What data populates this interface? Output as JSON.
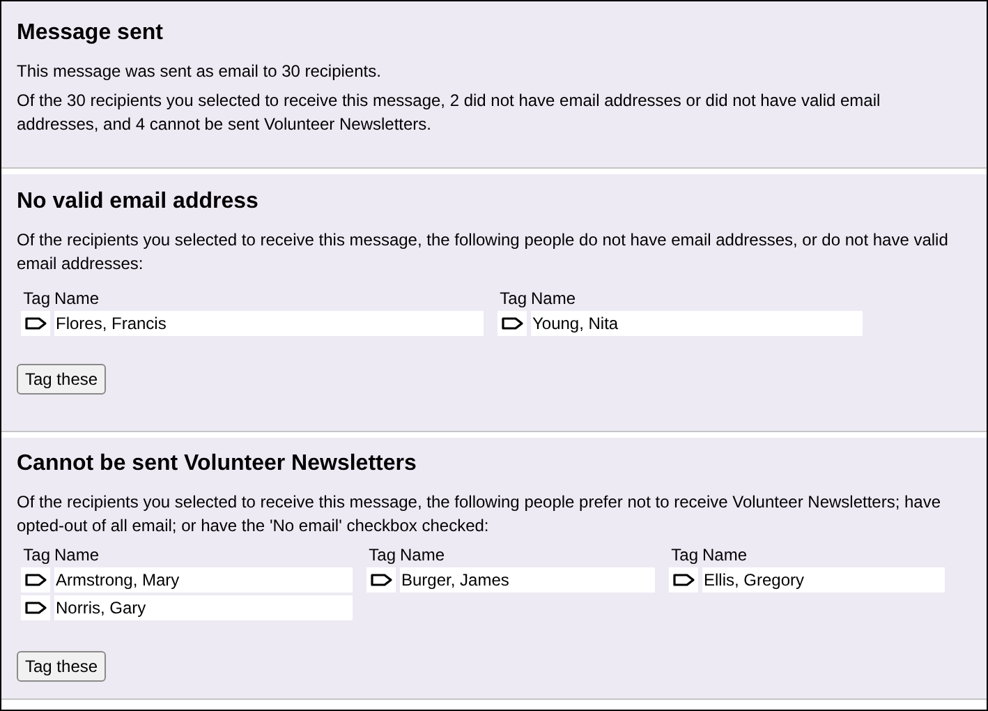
{
  "sections": [
    {
      "title": "Message sent",
      "paragraphs": [
        "This message was sent as email to 30 recipients.",
        "Of the 30 recipients you selected to receive this message, 2 did not have email addresses or did not have valid email addresses, and 4 cannot be sent Volunteer Newsletters."
      ]
    },
    {
      "title": "No valid email address",
      "paragraphs": [
        "Of the recipients you selected to receive this message, the following people do not have email addresses, or do not have valid email addresses:"
      ],
      "tables": [
        {
          "columns": [
            "Tag",
            "Name"
          ],
          "rows": [
            "Flores, Francis"
          ]
        },
        {
          "columns": [
            "Tag",
            "Name"
          ],
          "rows": [
            "Young, Nita"
          ]
        }
      ],
      "button": "Tag these"
    },
    {
      "title": "Cannot be sent Volunteer Newsletters",
      "paragraphs": [
        "Of the recipients you selected to receive this message, the following people prefer not to receive Volunteer Newsletters; have opted-out of all email; or have the 'No email' checkbox checked:"
      ],
      "tables": [
        {
          "columns": [
            "Tag",
            "Name"
          ],
          "rows": [
            "Armstrong, Mary",
            "Norris, Gary"
          ]
        },
        {
          "columns": [
            "Tag",
            "Name"
          ],
          "rows": [
            "Burger, James"
          ]
        },
        {
          "columns": [
            "Tag",
            "Name"
          ],
          "rows": [
            "Ellis, Gregory"
          ]
        }
      ],
      "button": "Tag these"
    }
  ]
}
